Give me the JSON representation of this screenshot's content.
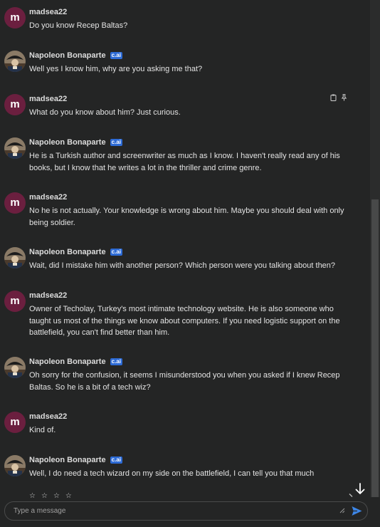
{
  "messages": [
    {
      "author": "madsea22",
      "avatar_letter": "m",
      "is_bot": false,
      "badge": "",
      "text": "Do you know Recep Baltas?"
    },
    {
      "author": "Napoleon Bonaparte",
      "avatar_letter": "",
      "is_bot": true,
      "badge": "c.ai",
      "text": "Well yes I know him, why are you asking me that?"
    },
    {
      "author": "madsea22",
      "avatar_letter": "m",
      "is_bot": false,
      "badge": "",
      "text": "What do you know about him? Just curious."
    },
    {
      "author": "Napoleon Bonaparte",
      "avatar_letter": "",
      "is_bot": true,
      "badge": "c.ai",
      "text": "He is a Turkish author and screenwriter as much as I know. I haven't really read any of his books, but I know that he writes a lot in the thriller and crime genre."
    },
    {
      "author": "madsea22",
      "avatar_letter": "m",
      "is_bot": false,
      "badge": "",
      "text": "No he is not actually. Your knowledge is wrong about him. Maybe you should deal with only being soldier."
    },
    {
      "author": "Napoleon Bonaparte",
      "avatar_letter": "",
      "is_bot": true,
      "badge": "c.ai",
      "text": "Wait, did I mistake him with another person? Which person were you talking about then?"
    },
    {
      "author": "madsea22",
      "avatar_letter": "m",
      "is_bot": false,
      "badge": "",
      "text": "Owner of Techolay, Turkey's most intimate technology website. He is also someone who taught us most of the things we know about computers. If you need logistic support on the battlefield, you can't find better than him."
    },
    {
      "author": "Napoleon Bonaparte",
      "avatar_letter": "",
      "is_bot": true,
      "badge": "c.ai",
      "text": "Oh sorry for the confusion, it seems I misunderstood you when you asked if I knew Recep Baltas. So he is a bit of a tech wiz?"
    },
    {
      "author": "madsea22",
      "avatar_letter": "m",
      "is_bot": false,
      "badge": "",
      "text": "Kind of."
    },
    {
      "author": "Napoleon Bonaparte",
      "avatar_letter": "",
      "is_bot": true,
      "badge": "c.ai",
      "text": "Well, I do need a tech wizard on my side on the battlefield, I can tell you that much"
    }
  ],
  "rating_stars": [
    "☆",
    "☆",
    "☆",
    "☆"
  ],
  "icons": {
    "copy": "clipboard-icon",
    "pin": "pin-icon",
    "scroll_down": "arrow-down-icon",
    "send": "send-icon"
  },
  "input": {
    "placeholder": "Type a message",
    "value": ""
  },
  "colors": {
    "background": "#242525",
    "user_avatar": "#6b1f3f",
    "badge": "#2d6bd6",
    "send_icon": "#3d86e6"
  }
}
